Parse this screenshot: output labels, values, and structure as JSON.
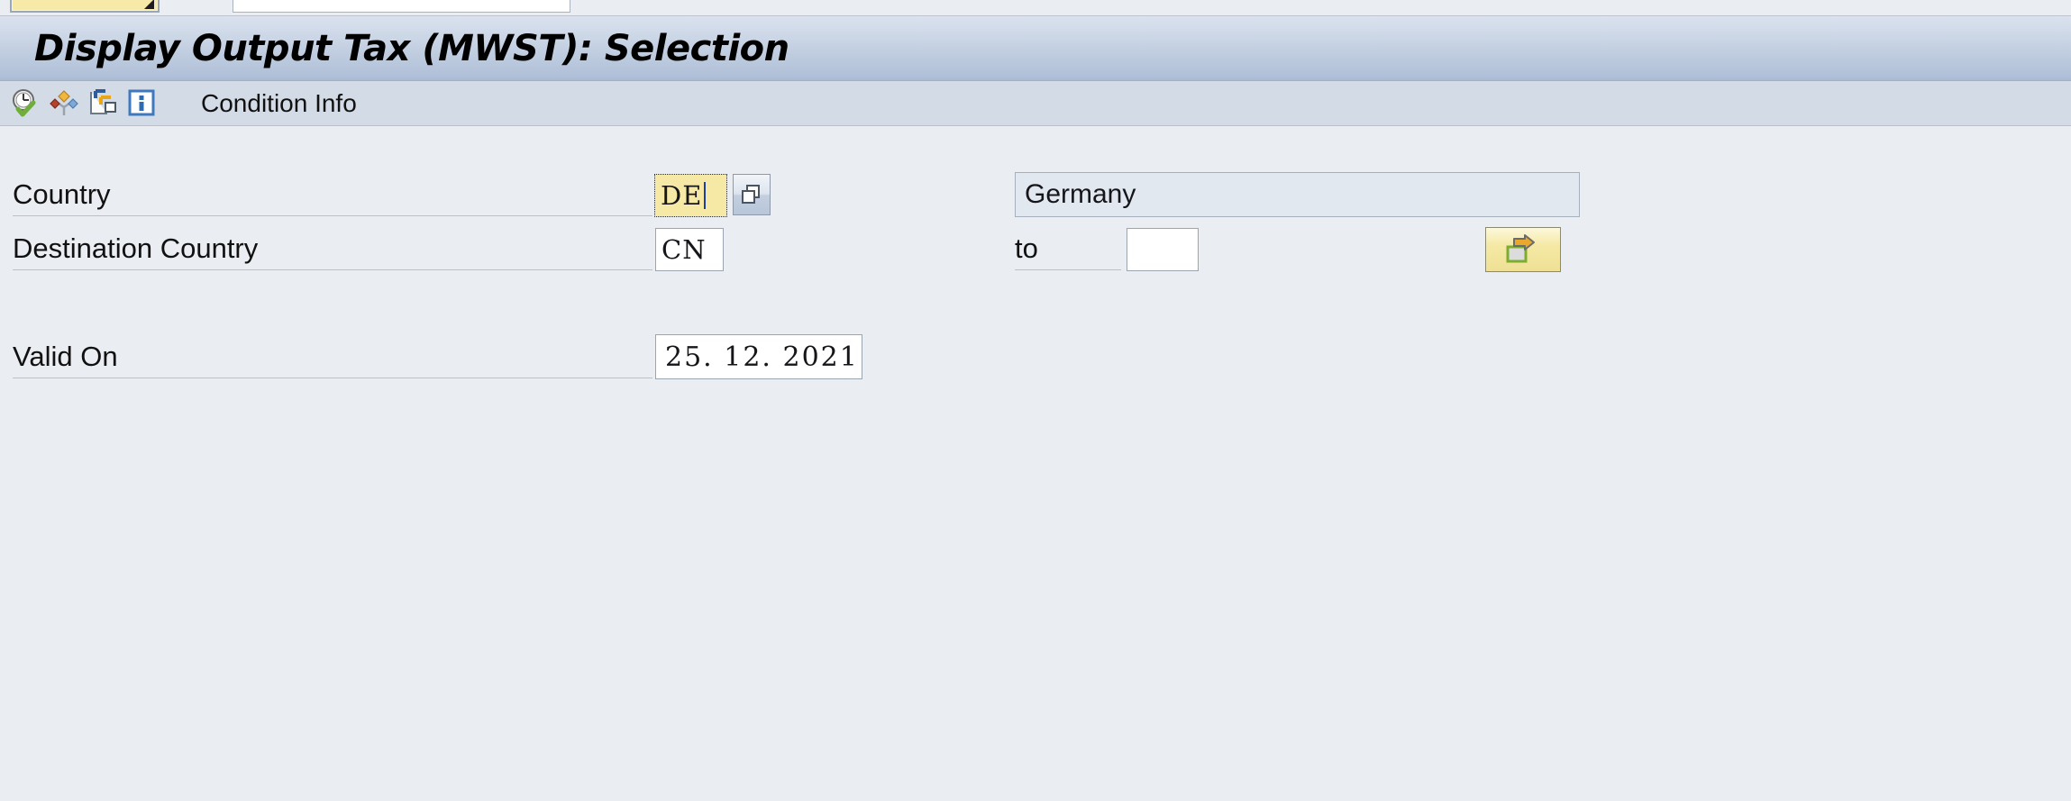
{
  "window": {
    "title": "Display Output Tax (MWST): Selection"
  },
  "command_bar": {
    "command_field_value": "",
    "command_field_placeholder": "",
    "okcode_field_value": "",
    "dropdown_icon": "triangle-down-icon"
  },
  "toolbar": {
    "label": "Condition Info",
    "buttons": [
      {
        "name": "validity-periods-button",
        "icon": "clock-check-icon",
        "title": "Validity Periods"
      },
      {
        "name": "condition-structure-button",
        "icon": "diamond-tree-icon",
        "title": "Condition Structure"
      },
      {
        "name": "copy-condition-button",
        "icon": "copy-icon",
        "title": "Copy"
      },
      {
        "name": "info-button",
        "icon": "info-icon",
        "title": "Info"
      }
    ]
  },
  "form": {
    "country": {
      "label": "Country",
      "value": "DE",
      "description": "Germany",
      "matchcode_icon": "matchcode-icon"
    },
    "destination_country": {
      "label": "Destination Country",
      "from_value": "CN",
      "to_label": "to",
      "to_value": "",
      "multiple_selection_icon": "multiple-selection-arrow-icon"
    },
    "valid_on": {
      "label": "Valid On",
      "value": "25. 12. 2021"
    }
  },
  "colors": {
    "title_bar_top": "#dae2ee",
    "title_bar_bottom": "#b0c0d8",
    "toolbar_bg": "#d3dbe6",
    "body_bg": "#eaeef2",
    "required_field_yellow": "#f6e9a6",
    "readonly_field": "#e2e8f0",
    "caret_blue": "#1b3ea8"
  }
}
